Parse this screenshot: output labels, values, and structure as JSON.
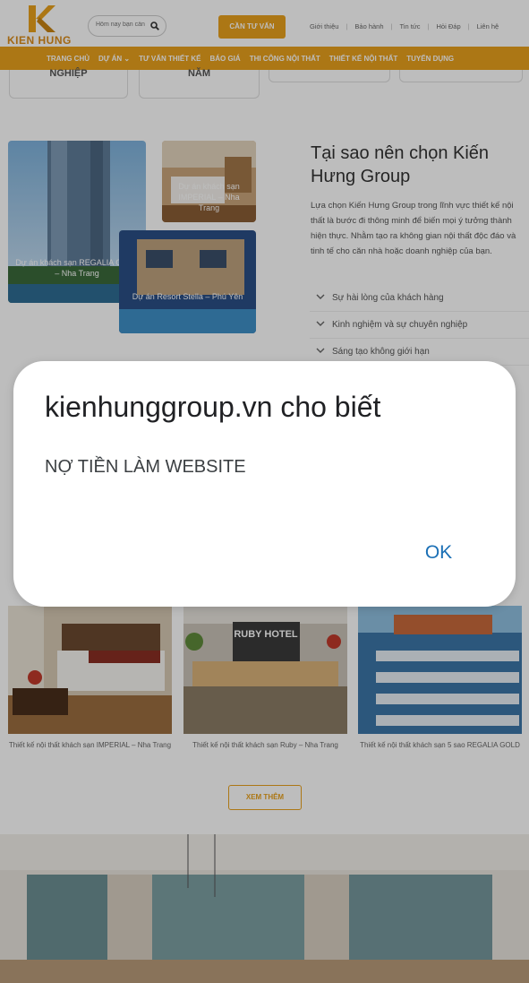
{
  "header": {
    "logo_text": "KIEN HUNG",
    "search_placeholder": "Hôm nay bạn cần",
    "advice_button": "CẦN TƯ VẤN",
    "top_links": [
      "Giới thiệu",
      "Bảo hành",
      "Tin tức",
      "Hỏi Đáp",
      "Liên hệ"
    ],
    "separator": "|"
  },
  "menu": {
    "items": [
      "TRANG CHỦ",
      "DỰ ÁN",
      "TƯ VẤN THIẾT KẾ",
      "BÁO GIÁ",
      "THI CÔNG NỘI THẤT",
      "THIẾT KẾ NỘI THẤT",
      "TUYỂN DỤNG"
    ]
  },
  "stats": {
    "box1": "NGHIỆP",
    "box2": "NĂM"
  },
  "why": {
    "title": "Tại sao nên chọn Kiến Hưng Group",
    "description": "Lựa chọn Kiến Hưng Group trong lĩnh vực thiết kế nội thất là bước đi thông minh để biến mọi ý tưởng thành hiện thực. Nhằm tạo ra không gian nội thất độc đáo và tinh tế cho căn nhà hoặc doanh nghiệp của bạn.",
    "photos": [
      "Dự án khách sạn REGALIA GOLD – Nha Trang",
      "Dự án khách sạn IMPERIAL – Nha Trang",
      "Dự án Resort Stella – Phú Yên"
    ],
    "accordion": [
      "Sự hài lòng của khách hàng",
      "Kinh nghiệm và sự chuyên nghiệp",
      "Sáng tạo không giới hạn"
    ]
  },
  "projects": {
    "items": [
      "Thiết kế nội thất khách sạn IMPERIAL – Nha Trang",
      "Thiết kế nội thất khách sạn Ruby – Nha Trang",
      "Thiết kế nội thất khách sạn 5 sao REGALIA GOLD"
    ],
    "sign_text": "RUBY HOTEL",
    "more_button": "XEM THÊM"
  },
  "dialog": {
    "title": "kienhunggroup.vn cho biết",
    "message": "NỢ TIỀN LÀM WEBSITE",
    "ok_button": "OK"
  },
  "colors": {
    "brand_orange": "#e9a11d",
    "dialog_button_blue": "#1a6fb5",
    "scrim": "rgba(0,0,0,0.26)"
  }
}
